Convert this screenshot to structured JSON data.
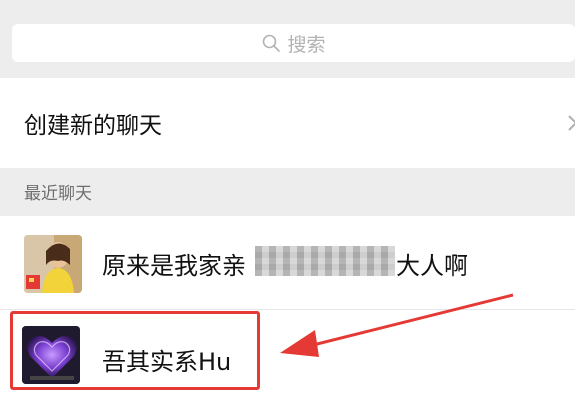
{
  "search": {
    "placeholder": "搜索",
    "icon": "search-icon"
  },
  "new_chat": {
    "label": "创建新的聊天",
    "chevron_icon": "chevron-right-icon"
  },
  "recent": {
    "header": "最近聊天"
  },
  "chats": [
    {
      "name_visible": "原来是我家亲",
      "name_end": "大人啊",
      "avatar": "photo-avatar",
      "name_obscured": true
    },
    {
      "name": "吾其实系Hu",
      "avatar": "purple-heart-avatar",
      "highlighted": true
    }
  ],
  "annotation": {
    "color": "#e53935",
    "type": "arrow-pointing-at-chat"
  }
}
